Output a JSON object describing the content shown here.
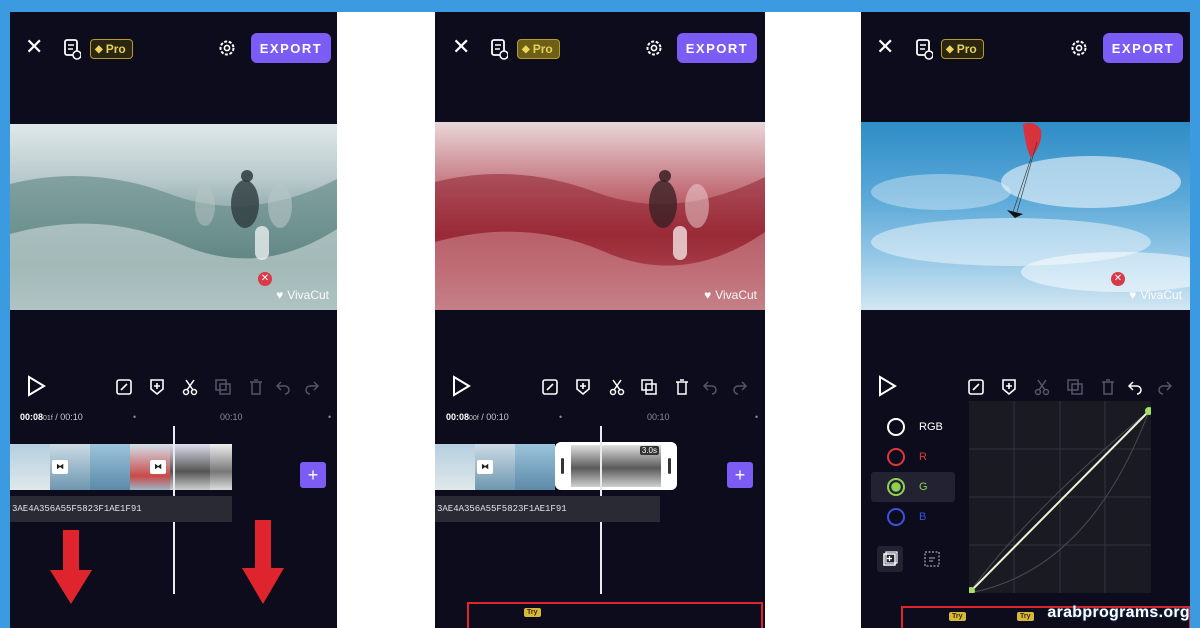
{
  "panels": [
    {
      "id": "left",
      "pro_label": "Pro",
      "export_label": "EXPORT",
      "time_current": "00:08",
      "time_frame": "01f",
      "time_total": "/ 00:10",
      "tick_label": "00:10",
      "audio_label": "3AE4A356A55F5823F1AE1F91",
      "watermark": "VivaCut"
    },
    {
      "id": "middle",
      "pro_label": "Pro",
      "export_label": "EXPORT",
      "time_current": "00:08",
      "time_frame": "00f",
      "time_total": "/ 00:10",
      "tick_label": "00:10",
      "clip_duration": "3.0s",
      "audio_label": "3AE4A356A55F5823F1AE1F91",
      "watermark": "VivaCut",
      "try_badge": "Try"
    },
    {
      "id": "right",
      "pro_label": "Pro",
      "export_label": "EXPORT",
      "watermark": "VivaCut",
      "channels": [
        {
          "label": "RGB",
          "color": "#ffffff"
        },
        {
          "label": "R",
          "color": "#e0353d"
        },
        {
          "label": "G",
          "color": "#8fd14f"
        },
        {
          "label": "B",
          "color": "#3f4fe0"
        }
      ],
      "try_badge": "Try"
    }
  ],
  "site_credit": "arabprograms.org",
  "colors": {
    "accent": "#7b5cf5",
    "pro_gold": "#e8cf5a",
    "highlight_red": "#e0242e",
    "frame_bg": "#3c9be0"
  }
}
